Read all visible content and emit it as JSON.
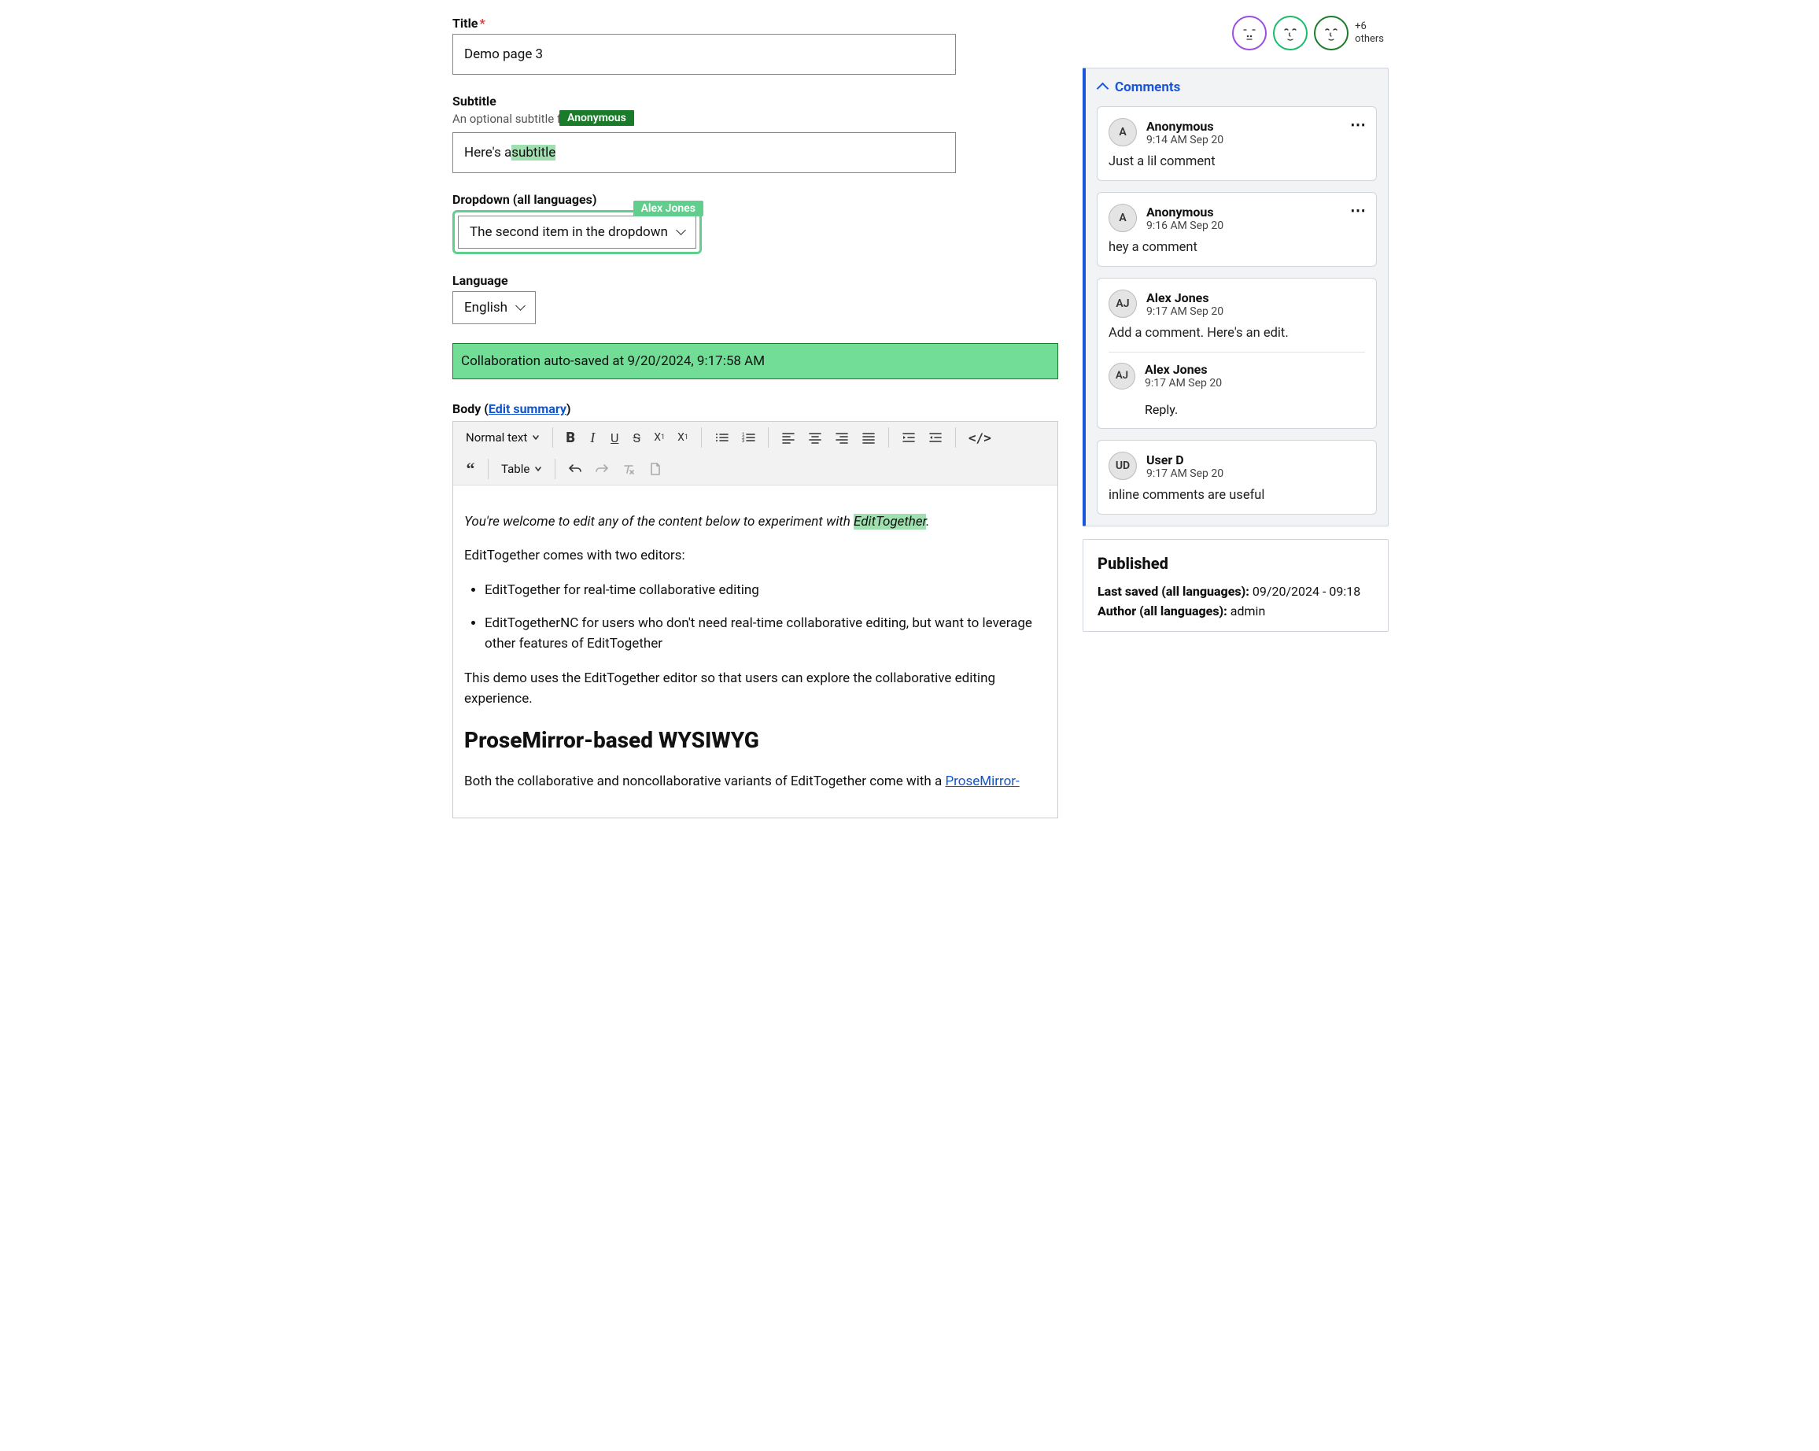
{
  "presence": {
    "others_count": "+6",
    "others_label": "others"
  },
  "fields": {
    "title": {
      "label": "Title",
      "required": "*",
      "value": "Demo page 3"
    },
    "subtitle": {
      "label": "Subtitle",
      "help": "An optional subtitle for the page.",
      "value_pre": "Here's a ",
      "value_hl": "subtitle",
      "annotator": "Anonymous"
    },
    "dropdown": {
      "label": "Dropdown (all languages)",
      "value": "The second item in the dropdown",
      "annotator": "Alex Jones"
    },
    "language": {
      "label": "Language",
      "value": "English"
    }
  },
  "autosave": "Collaboration auto-saved at 9/20/2024, 9:17:58 AM",
  "body": {
    "label_pre": "Body (",
    "edit_summary": "Edit summary",
    "label_post": ")",
    "toolbar": {
      "format": "Normal text",
      "table": "Table"
    },
    "content": {
      "intro_pre": "You're welcome to edit any of the content below to experiment with ",
      "intro_hl": "EditTogether",
      "intro_post": ".",
      "p2": "EditTogether comes with two editors:",
      "li1": "EditTogether for real-time collaborative editing",
      "li2": "EditTogetherNC for users who don't need real-time collaborative editing, but want to leverage other features of EditTogether",
      "p3": "This demo uses the EditTogether editor so that users can explore the collaborative editing experience.",
      "h2": "ProseMirror-based WYSIWYG",
      "p4_pre": "Both the collaborative and noncollaborative variants of EditTogether come with a ",
      "p4_link": "ProseMirror-"
    }
  },
  "comments": {
    "heading": "Comments",
    "items": [
      {
        "avatar": "A",
        "name": "Anonymous",
        "time": "9:14 AM Sep 20",
        "text": "Just a lil comment",
        "more": true
      },
      {
        "avatar": "A",
        "name": "Anonymous",
        "time": "9:16 AM Sep 20",
        "text": "hey a comment",
        "more": true
      },
      {
        "avatar": "AJ",
        "name": "Alex Jones",
        "time": "9:17 AM Sep 20",
        "text": "Add a comment. Here's an edit.",
        "reply": {
          "avatar": "AJ",
          "name": "Alex Jones",
          "time": "9:17 AM Sep 20",
          "text": "Reply."
        }
      },
      {
        "avatar": "UD",
        "name": "User D",
        "time": "9:17 AM Sep 20",
        "text": "inline comments are useful"
      }
    ]
  },
  "published": {
    "heading": "Published",
    "last_saved_label": "Last saved (all languages):",
    "last_saved_value": "09/20/2024 - 09:18",
    "author_label": "Author (all languages):",
    "author_value": "admin"
  }
}
